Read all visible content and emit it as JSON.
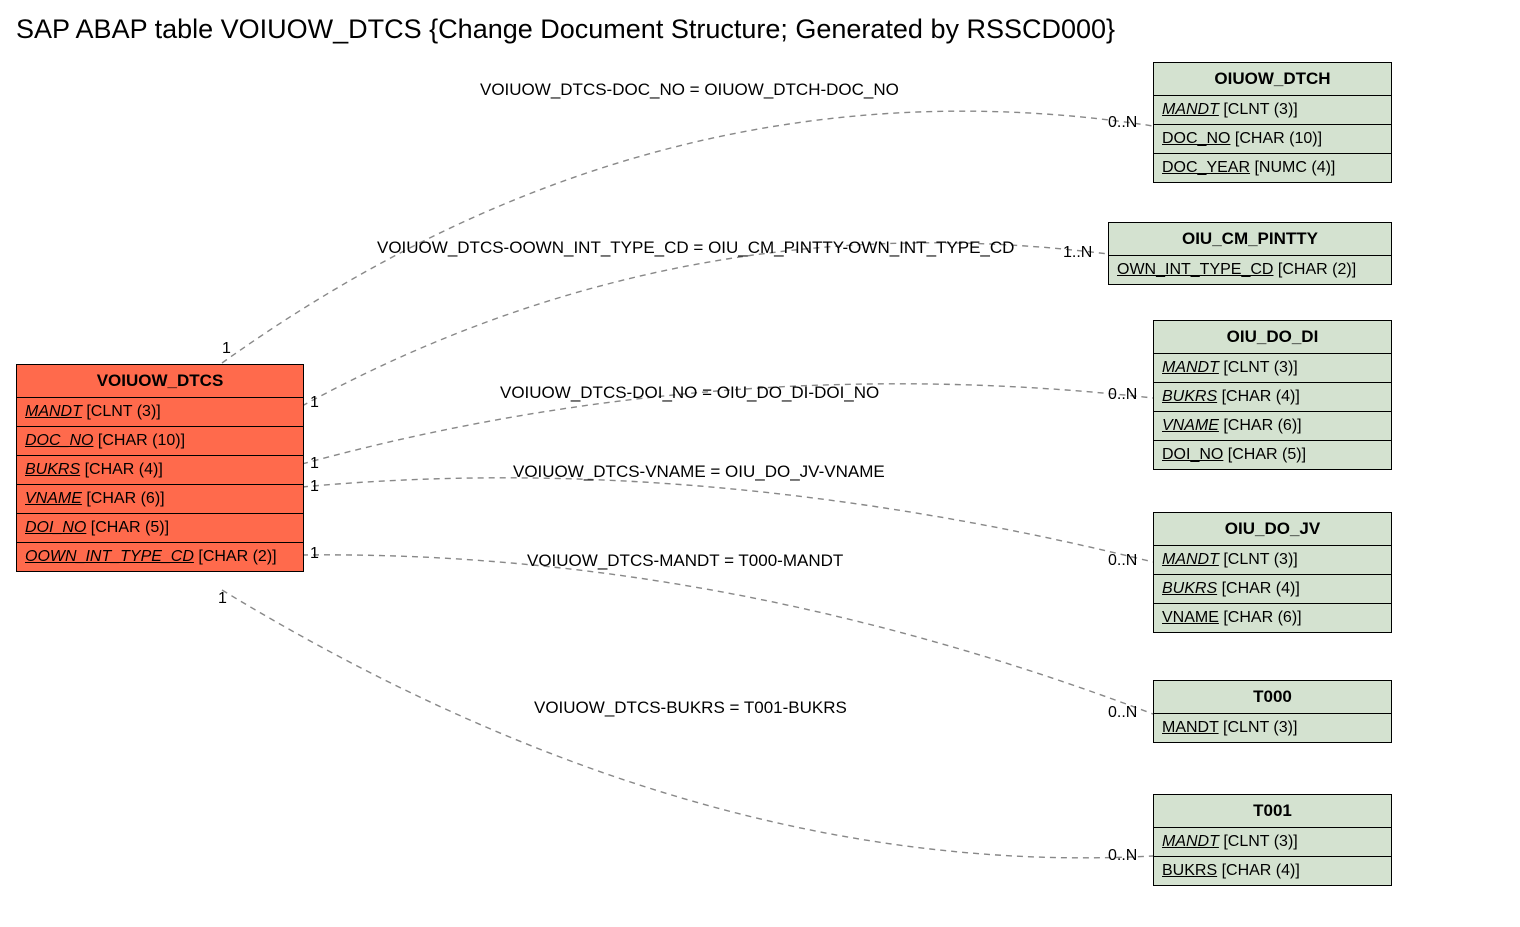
{
  "title": "SAP ABAP table VOIUOW_DTCS {Change Document Structure; Generated by RSSCD000}",
  "main_entity": {
    "name": "VOIUOW_DTCS",
    "fields": [
      {
        "name": "MANDT",
        "type": "[CLNT (3)]",
        "fk": true
      },
      {
        "name": "DOC_NO",
        "type": "[CHAR (10)]",
        "fk": true
      },
      {
        "name": "BUKRS",
        "type": "[CHAR (4)]",
        "fk": true
      },
      {
        "name": "VNAME",
        "type": "[CHAR (6)]",
        "fk": true
      },
      {
        "name": "DOI_NO",
        "type": "[CHAR (5)]",
        "fk": true
      },
      {
        "name": "OOWN_INT_TYPE_CD",
        "type": "[CHAR (2)]",
        "fk": true
      }
    ]
  },
  "targets": [
    {
      "name": "OIUOW_DTCH",
      "fields": [
        {
          "name": "MANDT",
          "type": "[CLNT (3)]",
          "fk": true
        },
        {
          "name": "DOC_NO",
          "type": "[CHAR (10)]",
          "fk": false
        },
        {
          "name": "DOC_YEAR",
          "type": "[NUMC (4)]",
          "fk": false
        }
      ]
    },
    {
      "name": "OIU_CM_PINTTY",
      "fields": [
        {
          "name": "OWN_INT_TYPE_CD",
          "type": "[CHAR (2)]",
          "fk": false
        }
      ]
    },
    {
      "name": "OIU_DO_DI",
      "fields": [
        {
          "name": "MANDT",
          "type": "[CLNT (3)]",
          "fk": true
        },
        {
          "name": "BUKRS",
          "type": "[CHAR (4)]",
          "fk": true
        },
        {
          "name": "VNAME",
          "type": "[CHAR (6)]",
          "fk": true
        },
        {
          "name": "DOI_NO",
          "type": "[CHAR (5)]",
          "fk": false
        }
      ]
    },
    {
      "name": "OIU_DO_JV",
      "fields": [
        {
          "name": "MANDT",
          "type": "[CLNT (3)]",
          "fk": true
        },
        {
          "name": "BUKRS",
          "type": "[CHAR (4)]",
          "fk": true
        },
        {
          "name": "VNAME",
          "type": "[CHAR (6)]",
          "fk": false
        }
      ]
    },
    {
      "name": "T000",
      "fields": [
        {
          "name": "MANDT",
          "type": "[CLNT (3)]",
          "fk": false
        }
      ]
    },
    {
      "name": "T001",
      "fields": [
        {
          "name": "MANDT",
          "type": "[CLNT (3)]",
          "fk": true
        },
        {
          "name": "BUKRS",
          "type": "[CHAR (4)]",
          "fk": false
        }
      ]
    }
  ],
  "relations": [
    {
      "label": "VOIUOW_DTCS-DOC_NO = OIUOW_DTCH-DOC_NO",
      "left_card": "1",
      "right_card": "0..N"
    },
    {
      "label": "VOIUOW_DTCS-OOWN_INT_TYPE_CD = OIU_CM_PINTTY-OWN_INT_TYPE_CD",
      "left_card": "1",
      "right_card": "1..N"
    },
    {
      "label": "VOIUOW_DTCS-DOI_NO = OIU_DO_DI-DOI_NO",
      "left_card": "1",
      "right_card": "0..N"
    },
    {
      "label": "VOIUOW_DTCS-VNAME = OIU_DO_JV-VNAME",
      "left_card": "1",
      "right_card": ""
    },
    {
      "label": "VOIUOW_DTCS-MANDT = T000-MANDT",
      "left_card": "1",
      "right_card": "0..N"
    },
    {
      "label": "VOIUOW_DTCS-BUKRS = T001-BUKRS",
      "left_card": "1",
      "right_card": "0..N"
    }
  ]
}
